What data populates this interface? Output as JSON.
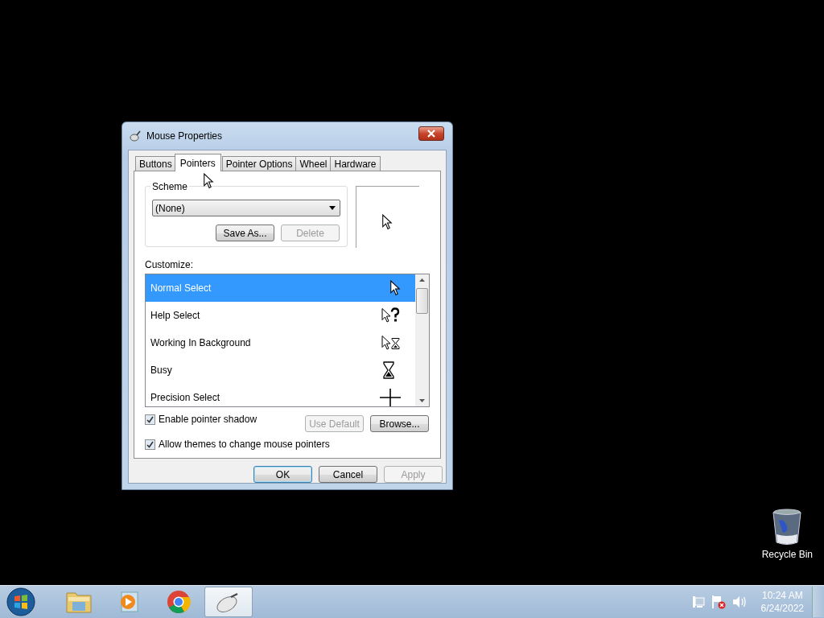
{
  "window": {
    "title": "Mouse Properties"
  },
  "tabs": [
    {
      "label": "Buttons",
      "selected": false
    },
    {
      "label": "Pointers",
      "selected": true
    },
    {
      "label": "Pointer Options",
      "selected": false
    },
    {
      "label": "Wheel",
      "selected": false
    },
    {
      "label": "Hardware",
      "selected": false
    }
  ],
  "scheme": {
    "label": "Scheme",
    "value": "(None)",
    "buttons": [
      {
        "label": "Save As...",
        "disabled": false
      },
      {
        "label": "Delete",
        "disabled": true
      }
    ]
  },
  "customize": {
    "label": "Customize:",
    "items": [
      {
        "label": "Normal Select",
        "selected": true,
        "kind": "arrow"
      },
      {
        "label": "Help Select",
        "selected": false,
        "kind": "help"
      },
      {
        "label": "Working In Background",
        "selected": false,
        "kind": "working"
      },
      {
        "label": "Busy",
        "selected": false,
        "kind": "busy"
      },
      {
        "label": "Precision Select",
        "selected": false,
        "kind": "precision"
      }
    ]
  },
  "list_buttons": [
    {
      "label": "Use Default",
      "disabled": true
    },
    {
      "label": "Browse...",
      "disabled": false
    }
  ],
  "options": [
    {
      "label": "Enable pointer shadow",
      "checked": true
    },
    {
      "label": "Allow themes to change mouse pointers",
      "checked": true
    }
  ],
  "dialog_buttons": [
    {
      "label": "OK",
      "disabled": false,
      "default": true
    },
    {
      "label": "Cancel",
      "disabled": false,
      "default": false
    },
    {
      "label": "Apply",
      "disabled": true,
      "default": false
    }
  ],
  "desktop_icons": [
    {
      "label": "Recycle Bin"
    }
  ],
  "taskbar": {
    "apps": [
      {
        "kind": "folder",
        "active": false
      },
      {
        "kind": "player",
        "active": false
      },
      {
        "kind": "browser",
        "active": false
      },
      {
        "kind": "mouse",
        "active": true
      }
    ],
    "clock": {
      "time": "10:24 AM",
      "date": "6/24/2022"
    }
  }
}
